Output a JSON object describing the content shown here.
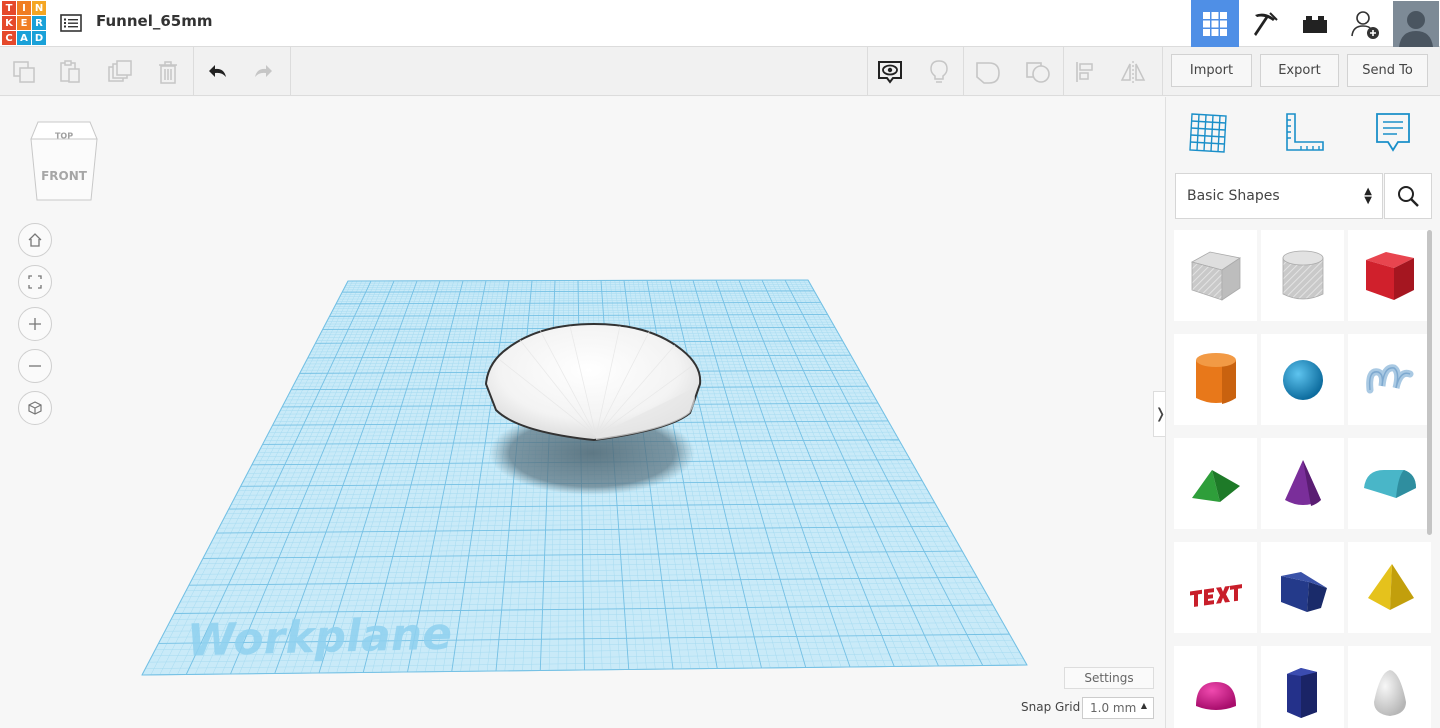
{
  "app": {
    "logo_letters": [
      "T",
      "I",
      "N",
      "K",
      "E",
      "R",
      "C",
      "A",
      "D"
    ],
    "logo_colors": [
      "#e5492b",
      "#f07d23",
      "#f5a623",
      "#e5492b",
      "#f07d23",
      "#1aa1d8",
      "#e5492b",
      "#1aa1d8",
      "#1aa1d8"
    ],
    "doc_title": "Funnel_65mm",
    "accent": "#4f8fe6"
  },
  "header_buttons": [
    {
      "name": "3d-design-view",
      "icon": "grid-view-icon",
      "active": true
    },
    {
      "name": "minecraft-view",
      "icon": "pickaxe-icon",
      "active": false
    },
    {
      "name": "bricks-view",
      "icon": "brick-icon",
      "active": false
    },
    {
      "name": "invite",
      "icon": "add-user-icon",
      "active": false
    },
    {
      "name": "profile",
      "icon": "avatar-icon",
      "active": false
    }
  ],
  "toolbar": {
    "copy_icon": "copy-icon",
    "paste_icon": "paste-icon",
    "duplicate_icon": "duplicate-icon",
    "delete_icon": "trash-icon",
    "undo_icon": "undo-icon",
    "redo_icon": "redo-icon",
    "notes_icon": "show-notes-icon",
    "light_icon": "lightbulb-icon",
    "group_icon": "group-icon",
    "ungroup_icon": "ungroup-icon",
    "align_icon": "align-icon",
    "mirror_icon": "mirror-icon",
    "import_label": "Import",
    "export_label": "Export",
    "send_label": "Send To"
  },
  "viewcube": {
    "top_label": "TOP",
    "front_label": "FRONT"
  },
  "nav_controls": [
    "home-icon",
    "fit-view-icon",
    "zoom-in-icon",
    "zoom-out-icon",
    "perspective-icon"
  ],
  "workplane": {
    "label": "Workplane",
    "grid_color": "#8fd0ee",
    "background": "#c6e9f7"
  },
  "footer": {
    "settings_label": "Settings",
    "snap_label": "Snap Grid",
    "snap_value": "1.0 mm"
  },
  "panel": {
    "panel_icons": [
      "workplane-grid-icon",
      "ruler-icon",
      "notes-icon"
    ],
    "shape_category": "Basic Shapes",
    "collapse_glyph": "❭",
    "shapes": [
      {
        "name": "box-hole",
        "icon": "box-hole-icon"
      },
      {
        "name": "cylinder-hole",
        "icon": "cylinder-hole-icon"
      },
      {
        "name": "box",
        "icon": "box-icon",
        "color": "#d0202c"
      },
      {
        "name": "cylinder",
        "icon": "cylinder-icon",
        "color": "#e8781a"
      },
      {
        "name": "sphere",
        "icon": "sphere-icon",
        "color": "#1b96d1"
      },
      {
        "name": "scribble",
        "icon": "scribble-icon",
        "color": "#a9c9e3"
      },
      {
        "name": "roof",
        "icon": "roof-icon",
        "color": "#2e9e3a"
      },
      {
        "name": "cone",
        "icon": "cone-icon",
        "color": "#7a2e9a"
      },
      {
        "name": "round-roof",
        "icon": "round-roof-icon",
        "color": "#49b6c8"
      },
      {
        "name": "text",
        "icon": "text-icon",
        "color": "#c81e2a"
      },
      {
        "name": "wedge",
        "icon": "wedge-icon",
        "color": "#243a8a"
      },
      {
        "name": "pyramid",
        "icon": "pyramid-icon",
        "color": "#e5c21c"
      },
      {
        "name": "half-sphere",
        "icon": "half-sphere-icon",
        "color": "#d6148a"
      },
      {
        "name": "polygon",
        "icon": "polygon-icon",
        "color": "#24318a"
      },
      {
        "name": "paraboloid",
        "icon": "paraboloid-icon",
        "color": "#d7d7d7"
      }
    ]
  }
}
